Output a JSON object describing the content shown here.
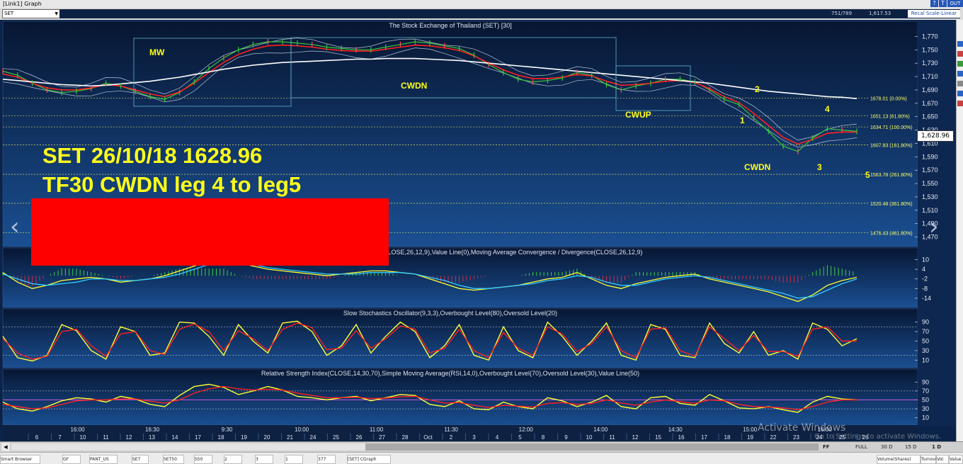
{
  "window": {
    "title": "[Link1] Graph",
    "controls": [
      "?",
      "T",
      "OUT"
    ]
  },
  "toolbar": {
    "symbol": "SET",
    "record_count": "751/789",
    "last_value": "1,617.53",
    "recal_label": "Recal Scale-Linear"
  },
  "annotations": {
    "headline1": "SET  26/10/18 1628.96",
    "headline2": "TF30 CWDN leg 4 to leg5",
    "mw": "MW",
    "cwdn1": "CWDN",
    "cwup": "CWUP",
    "cwdn2": "CWDN",
    "wave1": "1",
    "wave2": "2",
    "wave3": "3",
    "wave4": "4",
    "wave5": "5"
  },
  "bottom_bar": {
    "ff": "FF",
    "full": "FULL",
    "periods": [
      "30 D",
      "15 D",
      "1 D"
    ]
  },
  "status_tabs": [
    "Smart Browser",
    "GF",
    "PANT_US",
    "SET",
    "SET50",
    "S50",
    "2",
    "3",
    "1",
    "377",
    "[SET] CGraph",
    "Volume(Shares)",
    "Turnover",
    "Vol.",
    "Value"
  ],
  "watermark": {
    "line1": "Activate Windows",
    "line2": "Go to Settings to activate Windows."
  },
  "colors": {
    "background": "#0a2a55",
    "price": "#3cc43c",
    "ma_red": "#ff2020",
    "ma_white": "#ffffff",
    "stoch_k": "#ffff33",
    "stoch_d": "#ff2020",
    "macd_line": "#ffff33",
    "signal_line": "#33ccff",
    "annotation": "#ffff1a",
    "fib": "#ffff66"
  },
  "chart_data": [
    {
      "type": "line",
      "title": "The Stock Exchange of Thailand (SET) [30]",
      "current_price": "1,628.96",
      "ylim": [
        1460,
        1780
      ],
      "yticks": [
        "1,770",
        "1,750",
        "1,730",
        "1,710",
        "1,690",
        "1,670",
        "1,650",
        "1,630",
        "1,610",
        "1,590",
        "1,570",
        "1,550",
        "1,530",
        "1,510",
        "1,490",
        "1,470"
      ],
      "grid": false,
      "series": [
        {
          "values": [
            1718,
            1712,
            1700,
            1690,
            1686,
            1688,
            1692,
            1700,
            1696,
            1688,
            1680,
            1676,
            1686,
            1702,
            1722,
            1738,
            1750,
            1758,
            1762,
            1762,
            1760,
            1758,
            1754,
            1752,
            1750,
            1750,
            1754,
            1758,
            1762,
            1760,
            1756,
            1752,
            1742,
            1728,
            1716,
            1706,
            1702,
            1704,
            1708,
            1716,
            1712,
            1698,
            1690,
            1696,
            1700,
            1706,
            1706,
            1702,
            1690,
            1676,
            1668,
            1648,
            1628,
            1606,
            1598,
            1618,
            1632,
            1630,
            1628
          ]
        },
        {
          "values": [
            1714,
            1709,
            1700,
            1693,
            1690,
            1690,
            1693,
            1698,
            1696,
            1690,
            1684,
            1680,
            1687,
            1700,
            1716,
            1731,
            1743,
            1751,
            1756,
            1757,
            1756,
            1754,
            1751,
            1749,
            1748,
            1748,
            1751,
            1754,
            1757,
            1756,
            1753,
            1749,
            1741,
            1730,
            1720,
            1712,
            1707,
            1707,
            1709,
            1713,
            1711,
            1703,
            1697,
            1698,
            1700,
            1703,
            1704,
            1701,
            1692,
            1680,
            1671,
            1655,
            1637,
            1619,
            1609,
            1616,
            1625,
            1627,
            1627
          ]
        },
        {
          "values": [
            1706,
            1704,
            1702,
            1700,
            1698,
            1697,
            1696,
            1697,
            1699,
            1701,
            1703,
            1706,
            1709,
            1713,
            1717,
            1721,
            1724,
            1727,
            1729,
            1731,
            1732,
            1733,
            1734,
            1735,
            1736,
            1736,
            1737,
            1737,
            1737,
            1736,
            1735,
            1734,
            1732,
            1730,
            1728,
            1726,
            1724,
            1722,
            1720,
            1718,
            1716,
            1714,
            1712,
            1710,
            1708,
            1706,
            1704,
            1702,
            1700,
            1697,
            1694,
            1691,
            1688,
            1686,
            1684,
            1682,
            1680,
            1679,
            1677
          ]
        }
      ],
      "fib_levels": [
        {
          "value": 1678.01,
          "label": "1678.01 (0.00%)"
        },
        {
          "value": 1651.13,
          "label": "1651.13 (61.80%)"
        },
        {
          "value": 1634.71,
          "label": "1634.71 (100.00%)"
        },
        {
          "value": 1607.83,
          "label": "1607.83 (161.80%)"
        },
        {
          "value": 1563.78,
          "label": "1563.78 (261.80%)"
        },
        {
          "value": 1520.48,
          "label": "1520.48 (361.80%)"
        },
        {
          "value": 1476.43,
          "label": "1476.43 (461.80%)"
        }
      ]
    },
    {
      "type": "line",
      "title": "Moving Average Convergence / Divergence(CLOSE,26,12,9),Value Line(0),Moving Average Convergence / Divergence(CLOSE,26,12,9)",
      "ylim": [
        -18,
        12
      ],
      "yticks": [
        "10",
        "4",
        "-2",
        "-8",
        "-14"
      ],
      "series": [
        {
          "values": [
            2,
            -4,
            -8,
            -6,
            -3,
            -2,
            -1,
            -2,
            -4,
            -3,
            -2,
            0,
            3,
            6,
            9,
            10,
            8,
            6,
            4,
            3,
            2,
            1,
            0,
            1,
            2,
            3,
            3,
            2,
            1,
            -2,
            -5,
            -8,
            -9,
            -8,
            -7,
            -6,
            -4,
            -2,
            -1,
            2,
            -2,
            -6,
            -8,
            -5,
            -3,
            -1,
            0,
            1,
            -2,
            -4,
            -6,
            -8,
            -10,
            -13,
            -16,
            -12,
            -6,
            -3,
            -1
          ]
        },
        {
          "values": [
            1,
            -2,
            -5,
            -6,
            -5,
            -4,
            -2,
            -2,
            -3,
            -3,
            -2,
            -1,
            1,
            4,
            7,
            8,
            8,
            7,
            5,
            4,
            3,
            2,
            1,
            1,
            1,
            2,
            2,
            2,
            1,
            -1,
            -3,
            -6,
            -8,
            -8,
            -7,
            -6,
            -5,
            -3,
            -2,
            0,
            -1,
            -4,
            -6,
            -6,
            -4,
            -2,
            -1,
            0,
            -1,
            -3,
            -5,
            -7,
            -9,
            -11,
            -14,
            -13,
            -9,
            -5,
            -2
          ]
        }
      ]
    },
    {
      "type": "line",
      "title": "Slow Stochastics Oscillator(9,3,3),Overbought Level(80),Oversold Level(20)",
      "ylim": [
        0,
        100
      ],
      "yticks": [
        "90",
        "70",
        "50",
        "30",
        "10"
      ],
      "series": [
        {
          "values": [
            60,
            15,
            8,
            20,
            85,
            72,
            30,
            12,
            80,
            70,
            20,
            25,
            90,
            88,
            60,
            20,
            85,
            50,
            25,
            88,
            92,
            70,
            20,
            40,
            85,
            25,
            60,
            90,
            70,
            15,
            40,
            85,
            20,
            10,
            80,
            30,
            15,
            90,
            60,
            20,
            50,
            88,
            20,
            10,
            85,
            75,
            20,
            15,
            88,
            45,
            25,
            70,
            20,
            30,
            12,
            88,
            75,
            40,
            55
          ]
        },
        {
          "values": [
            55,
            25,
            12,
            18,
            70,
            75,
            40,
            18,
            65,
            70,
            30,
            22,
            75,
            86,
            70,
            30,
            72,
            55,
            30,
            75,
            88,
            78,
            32,
            35,
            72,
            35,
            55,
            82,
            75,
            25,
            35,
            75,
            30,
            15,
            68,
            35,
            20,
            80,
            65,
            28,
            45,
            80,
            30,
            15,
            75,
            78,
            30,
            18,
            80,
            55,
            30,
            62,
            28,
            28,
            18,
            75,
            80,
            50,
            50
          ]
        }
      ]
    },
    {
      "type": "line",
      "title": "Relative Strength Index(CLOSE,14,30,70),Simple Moving Average(RSI,14,0),Overbought Level(70),Oversold Level(30),Value Line(50)",
      "ylim": [
        0,
        100
      ],
      "yticks": [
        "90",
        "70",
        "50",
        "30",
        "10"
      ],
      "series": [
        {
          "values": [
            45,
            30,
            25,
            35,
            48,
            55,
            52,
            45,
            58,
            52,
            40,
            35,
            60,
            80,
            85,
            78,
            62,
            70,
            80,
            72,
            58,
            55,
            50,
            55,
            58,
            48,
            55,
            62,
            60,
            40,
            35,
            48,
            30,
            28,
            45,
            35,
            30,
            55,
            48,
            35,
            45,
            60,
            35,
            30,
            55,
            58,
            42,
            38,
            62,
            48,
            32,
            30,
            35,
            28,
            22,
            45,
            58,
            52,
            50
          ]
        },
        {
          "values": [
            40,
            35,
            30,
            32,
            40,
            48,
            50,
            50,
            52,
            52,
            47,
            43,
            50,
            65,
            75,
            80,
            75,
            72,
            74,
            72,
            65,
            60,
            55,
            55,
            56,
            53,
            54,
            57,
            58,
            50,
            43,
            44,
            38,
            33,
            38,
            36,
            34,
            42,
            44,
            40,
            42,
            50,
            43,
            38,
            45,
            50,
            46,
            42,
            50,
            48,
            40,
            35,
            34,
            32,
            28,
            35,
            45,
            50,
            50
          ]
        }
      ]
    }
  ],
  "xaxis": {
    "times": [
      {
        "i": 7,
        "label": "16:00"
      },
      {
        "i": 14,
        "label": "16:30"
      },
      {
        "i": 21,
        "label": "9:30"
      },
      {
        "i": 28,
        "label": "10:00"
      },
      {
        "i": 35,
        "label": "11:00"
      },
      {
        "i": 42,
        "label": "11:30"
      },
      {
        "i": 49,
        "label": "12:00"
      },
      {
        "i": 56,
        "label": "14:00"
      },
      {
        "i": 63,
        "label": "14:30"
      },
      {
        "i": 70,
        "label": "15:00"
      },
      {
        "i": 77,
        "label": "16:00"
      }
    ],
    "dates": [
      "6",
      "7",
      "10",
      "11",
      "12",
      "13",
      "14",
      "17",
      "18",
      "19",
      "20",
      "21",
      "24",
      "25",
      "26",
      "27",
      "28",
      "Oct",
      "2",
      "3",
      "4",
      "5",
      "8",
      "9",
      "10",
      "11",
      "12",
      "15",
      "16",
      "17",
      "18",
      "19",
      "22",
      "23",
      "24",
      "25",
      "26"
    ]
  }
}
